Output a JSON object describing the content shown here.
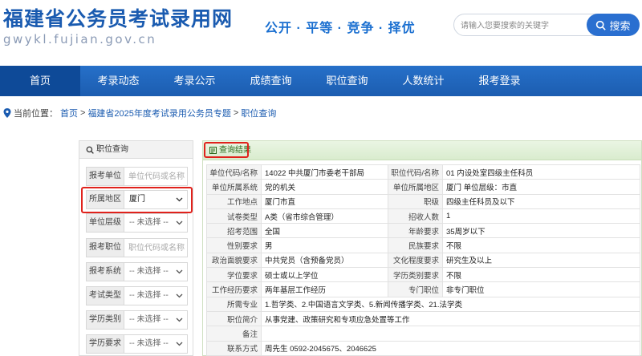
{
  "header": {
    "site_title": "福建省公务员考试录用网",
    "site_url": "gwykl.fujian.gov.cn",
    "slogan": "公开 · 平等 · 竞争 · 择优",
    "search_placeholder": "请输入您要搜索的关键字",
    "search_button": "搜索"
  },
  "nav": {
    "items": [
      "首页",
      "考录动态",
      "考录公示",
      "成绩查询",
      "职位查询",
      "人数统计",
      "报考登录"
    ],
    "active_index": 0
  },
  "breadcrumb": {
    "prefix": "当前位置：",
    "home": "首页",
    "sep": ">",
    "topic": "福建省2025年度考试录用公务员专题",
    "current": "职位查询"
  },
  "filter_panel": {
    "title": "职位查询",
    "fields": [
      {
        "label": "报考单位",
        "type": "input",
        "placeholder": "单位代码或名称",
        "value": ""
      },
      {
        "label": "所属地区",
        "type": "select",
        "value": "厦门"
      },
      {
        "label": "单位层级",
        "type": "select",
        "value": "-- 未选择 --"
      },
      {
        "label": "报考职位",
        "type": "input",
        "placeholder": "职位代码或名称",
        "value": ""
      },
      {
        "label": "报考系统",
        "type": "select",
        "value": "-- 未选择 --"
      },
      {
        "label": "考试类型",
        "type": "select",
        "value": "-- 未选择 --"
      },
      {
        "label": "学历类别",
        "type": "select",
        "value": "-- 未选择 --"
      },
      {
        "label": "学历要求",
        "type": "select",
        "value": "-- 未选择 --"
      }
    ]
  },
  "result_panel": {
    "title": "查询结果",
    "rows": [
      [
        {
          "l": "单位代码/名称",
          "v": "14022 中共厦门市委老干部局"
        },
        {
          "l": "职位代码/名称",
          "v": "01 内设处室四级主任科员"
        }
      ],
      [
        {
          "l": "单位所属系统",
          "v": "党的机关"
        },
        {
          "l": "单位所属地区",
          "v": "厦门   单位层级：市直"
        }
      ],
      [
        {
          "l": "工作地点",
          "v": "厦门市直"
        },
        {
          "l": "职级",
          "v": "四级主任科员及以下"
        }
      ],
      [
        {
          "l": "试卷类型",
          "v": "A类（省市综合管理）"
        },
        {
          "l": "招收人数",
          "v": "1"
        }
      ],
      [
        {
          "l": "招考范围",
          "v": "全国"
        },
        {
          "l": "年龄要求",
          "v": "35周岁以下"
        }
      ],
      [
        {
          "l": "性别要求",
          "v": "男"
        },
        {
          "l": "民族要求",
          "v": "不限"
        }
      ],
      [
        {
          "l": "政治面貌要求",
          "v": "中共党员（含预备党员）"
        },
        {
          "l": "文化程度要求",
          "v": "研究生及以上"
        }
      ],
      [
        {
          "l": "学位要求",
          "v": "硕士或以上学位"
        },
        {
          "l": "学历类别要求",
          "v": "不限"
        }
      ],
      [
        {
          "l": "工作经历要求",
          "v": "两年基层工作经历"
        },
        {
          "l": "专门职位",
          "v": "非专门职位"
        }
      ],
      [
        {
          "l": "所需专业",
          "v": "1.哲学类、2.中国语言文学类、5.新闻传播学类、21.法学类"
        }
      ],
      [
        {
          "l": "职位简介",
          "v": "从事党建、政策研究和专项应急处置等工作"
        }
      ],
      [
        {
          "l": "备注",
          "v": ""
        }
      ],
      [
        {
          "l": "联系方式",
          "v": "周先生 0592-2045675、2046625"
        }
      ]
    ]
  },
  "colors": {
    "brand_blue": "#1a5bb0",
    "nav_blue": "#2670c9",
    "highlight_red": "#e0221c",
    "result_green": "#d9ecce"
  }
}
